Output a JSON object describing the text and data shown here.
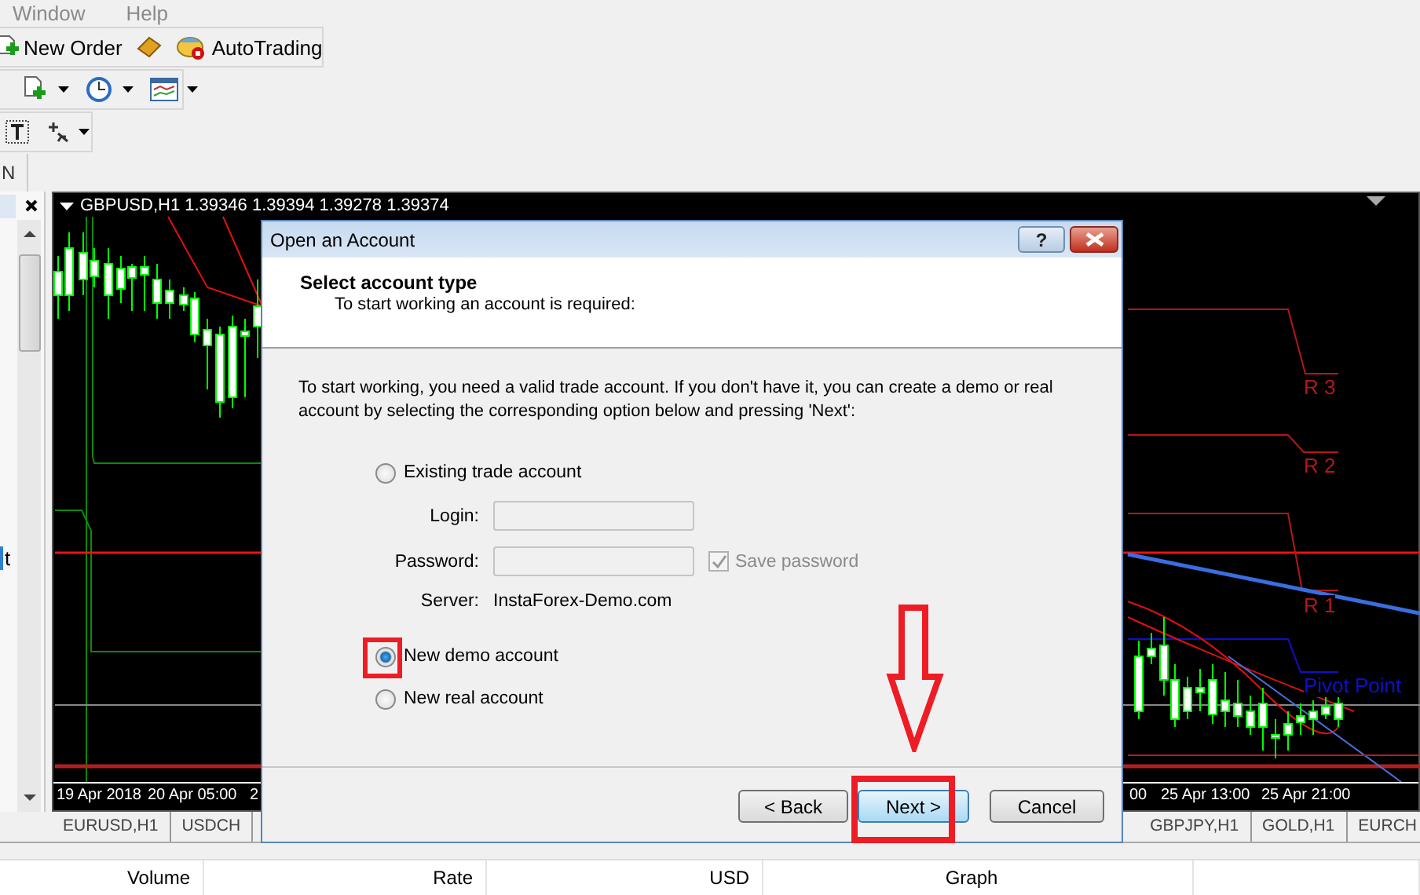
{
  "menu": [
    "Window",
    "Help"
  ],
  "toolbar": {
    "new_order": "New Order",
    "auto_trading": "AutoTrading"
  },
  "panel_row": {
    "label": "N"
  },
  "navigator": {
    "fragment": "t"
  },
  "chart": {
    "header": "GBPUSD,H1 1.39346 1.39394 1.39278 1.39374",
    "levels": [
      {
        "label": "R 3",
        "color": "#b41818"
      },
      {
        "label": "R 2",
        "color": "#b41818"
      },
      {
        "label": "R 1",
        "color": "#b41818"
      },
      {
        "label": "Pivot Point",
        "color": "#1010c8"
      }
    ],
    "time_labels": [
      "19 Apr 2018",
      "20 Apr 05:00",
      "2",
      "00",
      "25 Apr 13:00",
      "25 Apr 21:00"
    ]
  },
  "chart_tabs": [
    "EURUSD,H1",
    "USDCH",
    "GBPJPY,H1",
    "GOLD,H1",
    "EURCH"
  ],
  "dialog": {
    "title": "Open an Account",
    "help_glyph": "?",
    "heading": "Select account type",
    "subheading": "To start working an account is required:",
    "intro": "To start working, you need a valid trade account. If you don't have it, you can create a demo or real account by selecting the corresponding option below and pressing 'Next':",
    "options": [
      {
        "label": "Existing trade account",
        "selected": false
      },
      {
        "label": "New demo account",
        "selected": true
      },
      {
        "label": "New real account",
        "selected": false
      }
    ],
    "fields": [
      {
        "label": "Login:",
        "disabled": true
      },
      {
        "label": "Password:",
        "disabled": true
      }
    ],
    "save_password": {
      "label": "Save password",
      "checked": true,
      "disabled": true
    },
    "server": {
      "label": "Server:",
      "value": "InstaForex-Demo.com"
    },
    "buttons": [
      {
        "label": "< Back",
        "default": false
      },
      {
        "label": "Next >",
        "default": true
      },
      {
        "label": "Cancel",
        "default": false
      }
    ]
  },
  "annotations": {
    "frame_demo_option": true,
    "arrow_to_next": true,
    "frame_next": true
  },
  "columns": [
    "Volume",
    "Rate",
    "USD",
    "Graph"
  ]
}
